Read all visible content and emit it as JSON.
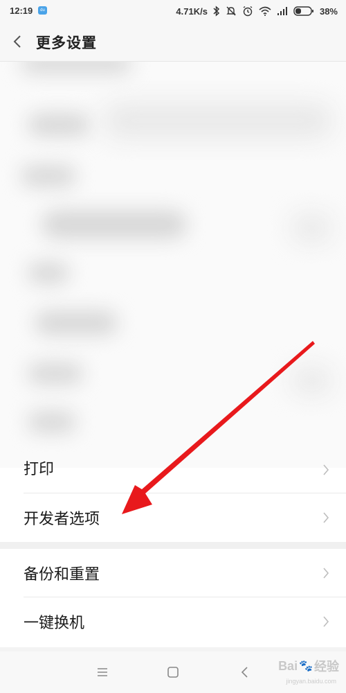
{
  "status_bar": {
    "time": "12:19",
    "app_badge": "du",
    "net_speed": "4.71K/s",
    "battery_percent": "38%",
    "icons": [
      "bluetooth-icon",
      "mute-icon",
      "alarm-icon",
      "wifi-icon",
      "signal-icon",
      "battery-icon"
    ],
    "battery_level": 0.38
  },
  "header": {
    "title": "更多设置",
    "back_icon": "chevron-left-icon"
  },
  "list": {
    "items": [
      {
        "label": "打印"
      },
      {
        "label": "开发者选项"
      },
      {
        "label": "备份和重置"
      },
      {
        "label": "一键换机"
      }
    ]
  },
  "nav_bar": {
    "icons": [
      "menu-icon",
      "home-icon",
      "back-icon"
    ]
  },
  "watermark": {
    "brand": "Bai",
    "brand_suffix": "经验",
    "site": "jingyan.baidu.com"
  },
  "colors": {
    "annotation_arrow": "#e8191c",
    "background": "#f3f3f3",
    "row_background": "#ffffff"
  }
}
